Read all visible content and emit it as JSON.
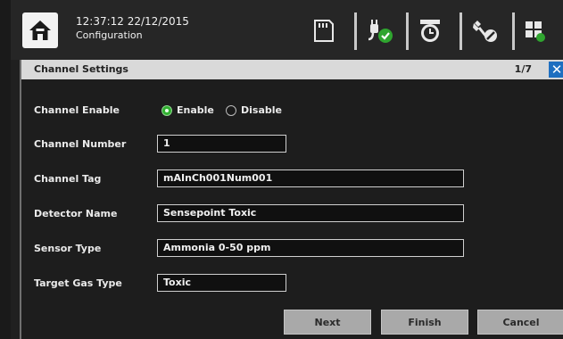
{
  "status": {
    "time": "12:37:12",
    "date": "22/12/2015",
    "screen_name": "Configuration"
  },
  "toolbar_icons": [
    "home-icon",
    "sd-card-icon",
    "power-plug-check-icon",
    "alarm-clock-icon",
    "wrench-icon",
    "grid-layout-icon"
  ],
  "dialog": {
    "title": "Channel Settings",
    "page_indicator": "1/7",
    "close_glyph": "✕"
  },
  "form": {
    "channel_enable": {
      "label": "Channel Enable",
      "options": [
        "Enable",
        "Disable"
      ],
      "selected": "Enable"
    },
    "channel_number": {
      "label": "Channel Number",
      "value": "1"
    },
    "channel_tag": {
      "label": "Channel Tag",
      "value": "mAInCh001Num001"
    },
    "detector_name": {
      "label": "Detector Name",
      "value": "Sensepoint Toxic"
    },
    "sensor_type": {
      "label": "Sensor Type",
      "value": "Ammonia 0-50 ppm"
    },
    "target_gas_type": {
      "label": "Target Gas Type",
      "value": "Toxic"
    }
  },
  "buttons": {
    "next": "Next",
    "finish": "Finish",
    "cancel": "Cancel"
  },
  "colors": {
    "accent_green": "#30b030",
    "close_blue": "#1f6fc0",
    "button_grey": "#a9a9a9"
  }
}
